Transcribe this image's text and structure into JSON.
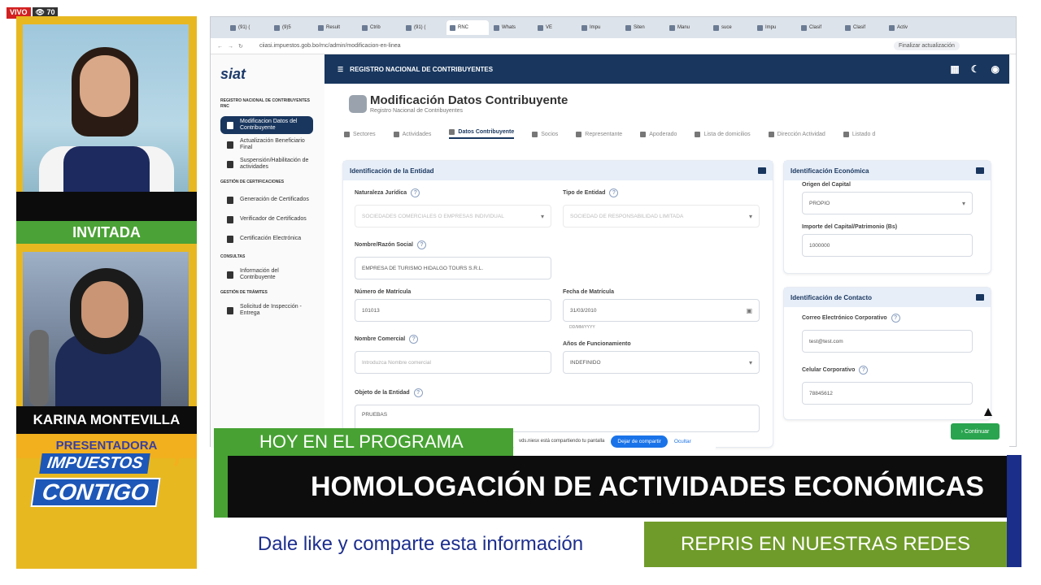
{
  "live": {
    "label": "VIVO",
    "viewers": "70"
  },
  "left_panel": {
    "guest_label": "INVITADA",
    "presenter_name": "KARINA MONTEVILLA",
    "presenter_role": "PRESENTADORA",
    "show_logo_line1": "IMPUESTOS",
    "show_logo_line2": "CONTIGO"
  },
  "browser": {
    "tabs": [
      "(91) (",
      "(9)5",
      "Result",
      "Ctrib",
      "(91) (",
      "RNC",
      "Whats",
      "VE",
      "Impu",
      "Siten",
      "Manu",
      "suce",
      "Impu",
      "Clasif",
      "Clasif",
      "Activ"
    ],
    "active_tab": 5,
    "url": "ciiasi.impuestos.gob.bo/rnc/admin/modificacion-en-linea",
    "finalize_label": "Finalizar actualización"
  },
  "app": {
    "brand": "siat",
    "header_title": "REGISTRO NACIONAL DE CONTRIBUYENTES",
    "page_title": "Modificación Datos Contribuyente",
    "page_subtitle": "Registro Nacional de Contribuyentes",
    "sidebar": {
      "sections": [
        "REGISTRO NACIONAL DE CONTRIBUYENTES RNC",
        "GESTIÓN DE CERTIFICACIONES",
        "CONSULTAS",
        "GESTIÓN DE TRÁMITES"
      ],
      "items": [
        "Modificacion Datos del Contribuyente",
        "Actualización Beneficiario Final",
        "Suspensión/Habilitación de actividades",
        "Generación de Certificados",
        "Verificador de Certificados",
        "Certificación Electrónica",
        "Información del Contribuyente",
        "Solicitud de Inspección - Entrega"
      ]
    },
    "tabs": [
      "Sectores",
      "Actividades",
      "Datos Contribuyente",
      "Socios",
      "Representante",
      "Apoderado",
      "Lista de domicilios",
      "Dirección Actividad",
      "Listado d"
    ],
    "active_tab_index": 2,
    "entity_card": {
      "title": "Identificación de la Entidad",
      "naturaleza_label": "Naturaleza Jurídica",
      "naturaleza_value": "SOCIEDADES COMERCIALES O EMPRESAS INDIVIDUAL",
      "tipo_label": "Tipo de Entidad",
      "tipo_value": "SOCIEDAD DE RESPONSABILIDAD LIMITADA",
      "razon_label": "Nombre/Razón Social",
      "razon_value": "EMPRESA DE TURISMO HIDALGO TOURS S.R.L.",
      "matricula_label": "Número de Matrícula",
      "matricula_value": "101013",
      "fecha_label": "Fecha de Matrícula",
      "fecha_value": "31/03/2010",
      "fecha_hint": "DD/MM/YYYY",
      "comercial_label": "Nombre Comercial",
      "comercial_placeholder": "Introduzca Nombre comercial",
      "anos_label": "Años de Funcionamiento",
      "anos_value": "INDEFINIDO",
      "objeto_label": "Objeto de la Entidad",
      "objeto_value": "PRUEBAS"
    },
    "economic_card": {
      "title": "Identificación Económica",
      "origen_label": "Origen del Capital",
      "origen_value": "PROPIO",
      "importe_label": "Importe del Capital/Patrimonio (Bs)",
      "importe_value": "1000000"
    },
    "contact_card": {
      "title": "Identificación de Contacto",
      "correo_label": "Correo Electrónico Corporativo",
      "correo_value": "test@test.com",
      "celular_label": "Celular Corporativo",
      "celular_value": "78845612"
    },
    "continue_label": "Continuar"
  },
  "share_bar": {
    "text": "vds.niesx está compartiendo tu pantalla",
    "stop_label": "Dejar de compartir",
    "hide_label": "Ocultar"
  },
  "lower_third": {
    "today_label": "HOY EN EL PROGRAMA",
    "headline": "HOMOLOGACIÓN DE ACTIVIDADES ECONÓMICAS",
    "like_text": "Dale like y comparte esta información",
    "repris_text": "REPRIS EN NUESTRAS REDES"
  },
  "colors": {
    "navy": "#18365e",
    "green": "#47a233",
    "gold": "#e8b821",
    "brand_blue": "#1d57b8",
    "repris_green": "#6f9b2a"
  }
}
